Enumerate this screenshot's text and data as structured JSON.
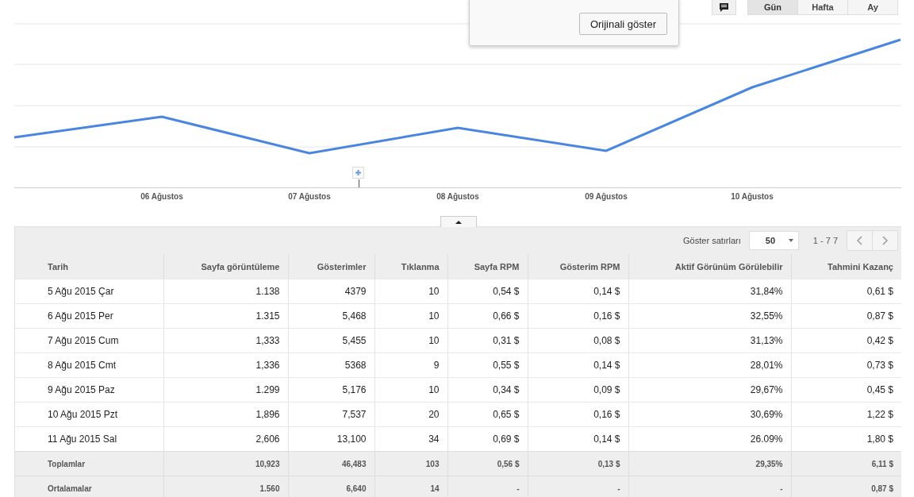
{
  "popup": {
    "button": "Orijinali göster"
  },
  "view_toggle": [
    {
      "label": "Gün",
      "selected": true
    },
    {
      "label": "Hafta",
      "selected": false
    },
    {
      "label": "Ay",
      "selected": false
    }
  ],
  "chart": {
    "x_labels": [
      "06 Ağustos",
      "07 Ağustos",
      "08 Ağustos",
      "09 Ağustos",
      "10 Ağustos"
    ]
  },
  "table": {
    "toolbar": {
      "rows_label": "Göster satırları",
      "rows_value": "50",
      "range": "1 - 7 7"
    },
    "columns": [
      "Tarih",
      "Sayfa görüntüleme",
      "Gösterimler",
      "Tıklanma",
      "Sayfa RPM",
      "Gösterim RPM",
      "Aktif Görünüm Görülebilir",
      "Tahmini Kazanç"
    ],
    "rows": [
      [
        "5 Ağu 2015 Çar",
        "1.138",
        "4379",
        "10",
        "0,54 $",
        "0,14 $",
        "31,84%",
        "0,61 $"
      ],
      [
        "6 Ağu 2015 Per",
        "1.315",
        "5,468",
        "10",
        "0,66 $",
        "0,16 $",
        "32,55%",
        "0,87 $"
      ],
      [
        "7 Ağu 2015 Cum",
        "1,333",
        "5,455",
        "10",
        "0,31 $",
        "0,08 $",
        "31,13%",
        "0,42 $"
      ],
      [
        "8 Ağu 2015 Cmt",
        "1,336",
        "5368",
        "9",
        "0,55 $",
        "0,14 $",
        "28,01%",
        "0,73 $"
      ],
      [
        "9 Ağu 2015 Paz",
        "1.299",
        "5,176",
        "10",
        "0,34 $",
        "0,09 $",
        "29,67%",
        "0,45 $"
      ],
      [
        "10 Ağu 2015 Pzt",
        "1,896",
        "7,537",
        "20",
        "0,65 $",
        "0,16 $",
        "30,69%",
        "1,22 $"
      ],
      [
        "11 Ağu 2015 Sal",
        "2,606",
        "13,100",
        "34",
        "0,69 $",
        "0,14 $",
        "26.09%",
        "1,80 $"
      ]
    ],
    "totals": [
      "Toplamlar",
      "10,923",
      "46,483",
      "103",
      "0,56 $",
      "0,13 $",
      "29,35%",
      "6,11 $"
    ],
    "averages": [
      "Ortalamalar",
      "1.560",
      "6,640",
      "14",
      "-",
      "-",
      "-",
      "0,87 $"
    ]
  }
}
